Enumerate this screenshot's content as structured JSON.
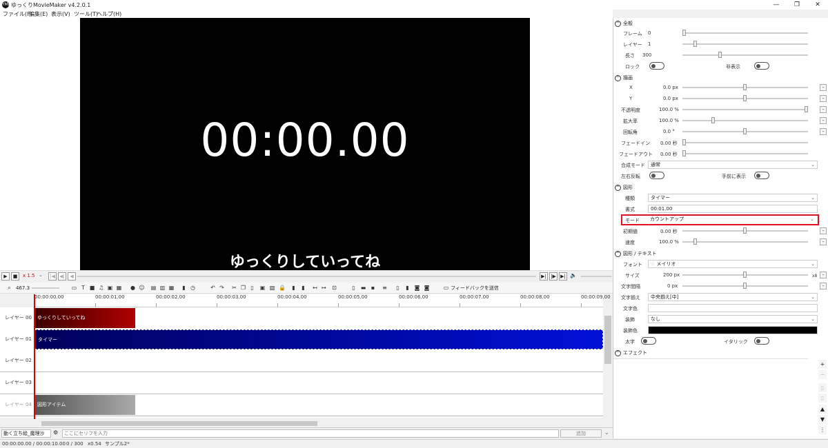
{
  "window": {
    "title": "ゆっくりMovieMaker v4.2.0.1",
    "icon": "YMM",
    "min": "—",
    "max": "❐",
    "close": "✕"
  },
  "menu": [
    "ファイル(F)",
    "編集(E)",
    "表示(V)",
    "ツール(T)",
    "ヘルプ(H)"
  ],
  "preview": {
    "timer": "00:00.00",
    "subtitle": "ゆっくりしていってね"
  },
  "playback": {
    "speed": "x 1.5",
    "zoom": "467.3"
  },
  "toolbar": {
    "feedback": "フィードバックを送信"
  },
  "ruler": [
    "00:00:00.00",
    "00:00:01.00",
    "00:00:02.00",
    "00:00:03.00",
    "00:00:04.00",
    "00:00:05.00",
    "00:00:06.00",
    "00:00:07.00",
    "00:00:08.00",
    "00:00:09.00"
  ],
  "layers": [
    {
      "name": "レイヤー 00",
      "clip": "ゆっくりしていってね"
    },
    {
      "name": "レイヤー 01",
      "clip": "タイマー"
    },
    {
      "name": "レイヤー 02",
      "clip": ""
    },
    {
      "name": "レイヤー 03",
      "clip": ""
    },
    {
      "name": "レイヤー 04",
      "clip": "図形アイテム"
    }
  ],
  "bottom": {
    "character": "動く立ち絵_魔理沙",
    "placeholder": "ここにセリフを入力",
    "add": "追加"
  },
  "status": {
    "time": "00:00:00.00 / 00:00:10.00",
    "frame": "0 / 300",
    "scale": "x0.54",
    "project": "サンプル2*"
  },
  "panel": {
    "sec_general": "全般",
    "frame_l": "フレーム",
    "frame_v": "0",
    "layer_l": "レイヤー",
    "layer_v": "1",
    "length_l": "長さ",
    "length_v": "300",
    "lock_l": "ロック",
    "hide_l": "非表示",
    "sec_draw": "描画",
    "x_l": "X",
    "x_v": "0.0 px",
    "y_l": "Y",
    "y_v": "0.0 px",
    "op_l": "不透明度",
    "op_v": "100.0 %",
    "zoom_l": "拡大率",
    "zoom_v": "100.0 %",
    "rot_l": "回転角",
    "rot_v": "0.0 °",
    "fin_l": "フェードイン",
    "fin_v": "0.00 秒",
    "fout_l": "フェードアウト",
    "fout_v": "0.00 秒",
    "blend_l": "合成モード",
    "blend_v": "通常",
    "flip_l": "左右反転",
    "front_l": "手前に表示",
    "sec_shape": "図形",
    "kind_l": "種類",
    "kind_v": "タイマー",
    "fmt_l": "書式",
    "fmt_v": "00:01.00",
    "mode_l": "モード",
    "mode_v": "カウントアップ",
    "init_l": "初期値",
    "init_v": "0.00 秒",
    "speed_l": "速度",
    "speed_v": "100.0 %",
    "sec_text": "図形 / テキスト",
    "font_l": "フォント",
    "font_v": "メイリオ",
    "size_l": "サイズ",
    "size_v": "200 px",
    "size_x": "x8",
    "space_l": "文字間隔",
    "space_v": "0 px",
    "align_l": "文字揃え",
    "align_v": "中央揃え[中]",
    "color_l": "文字色",
    "deco_l": "装飾",
    "deco_v": "なし",
    "decocolor_l": "装飾色",
    "bold_l": "太字",
    "italic_l": "イタリック",
    "sec_effect": "エフェクト"
  }
}
